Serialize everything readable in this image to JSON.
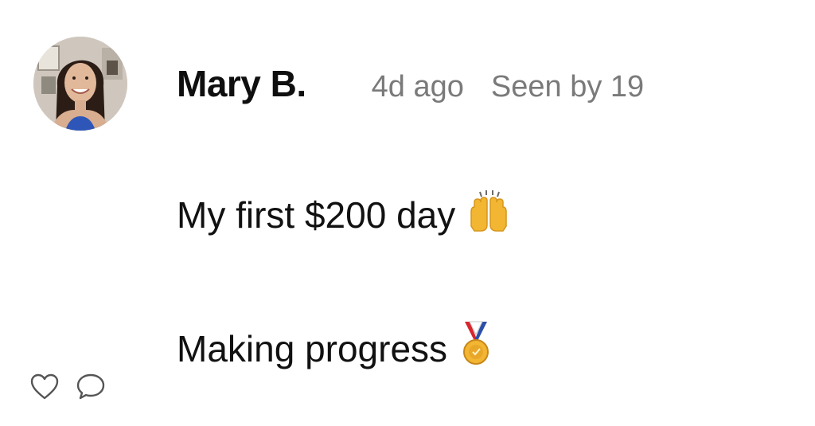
{
  "post": {
    "author": "Mary B.",
    "time_ago": "4d ago",
    "seen_by": "Seen by 19",
    "lines": [
      {
        "text": "My first $200 day",
        "emoji": "raising-hands-emoji"
      },
      {
        "text": "Making progress",
        "emoji": "medal-emoji"
      }
    ]
  },
  "actions": {
    "like_icon": "heart-icon",
    "comment_icon": "comment-bubble-icon"
  },
  "colors": {
    "text": "#111111",
    "meta": "#7a7a7a",
    "icon": "#555555",
    "emoji_gold": "#f2b632"
  }
}
